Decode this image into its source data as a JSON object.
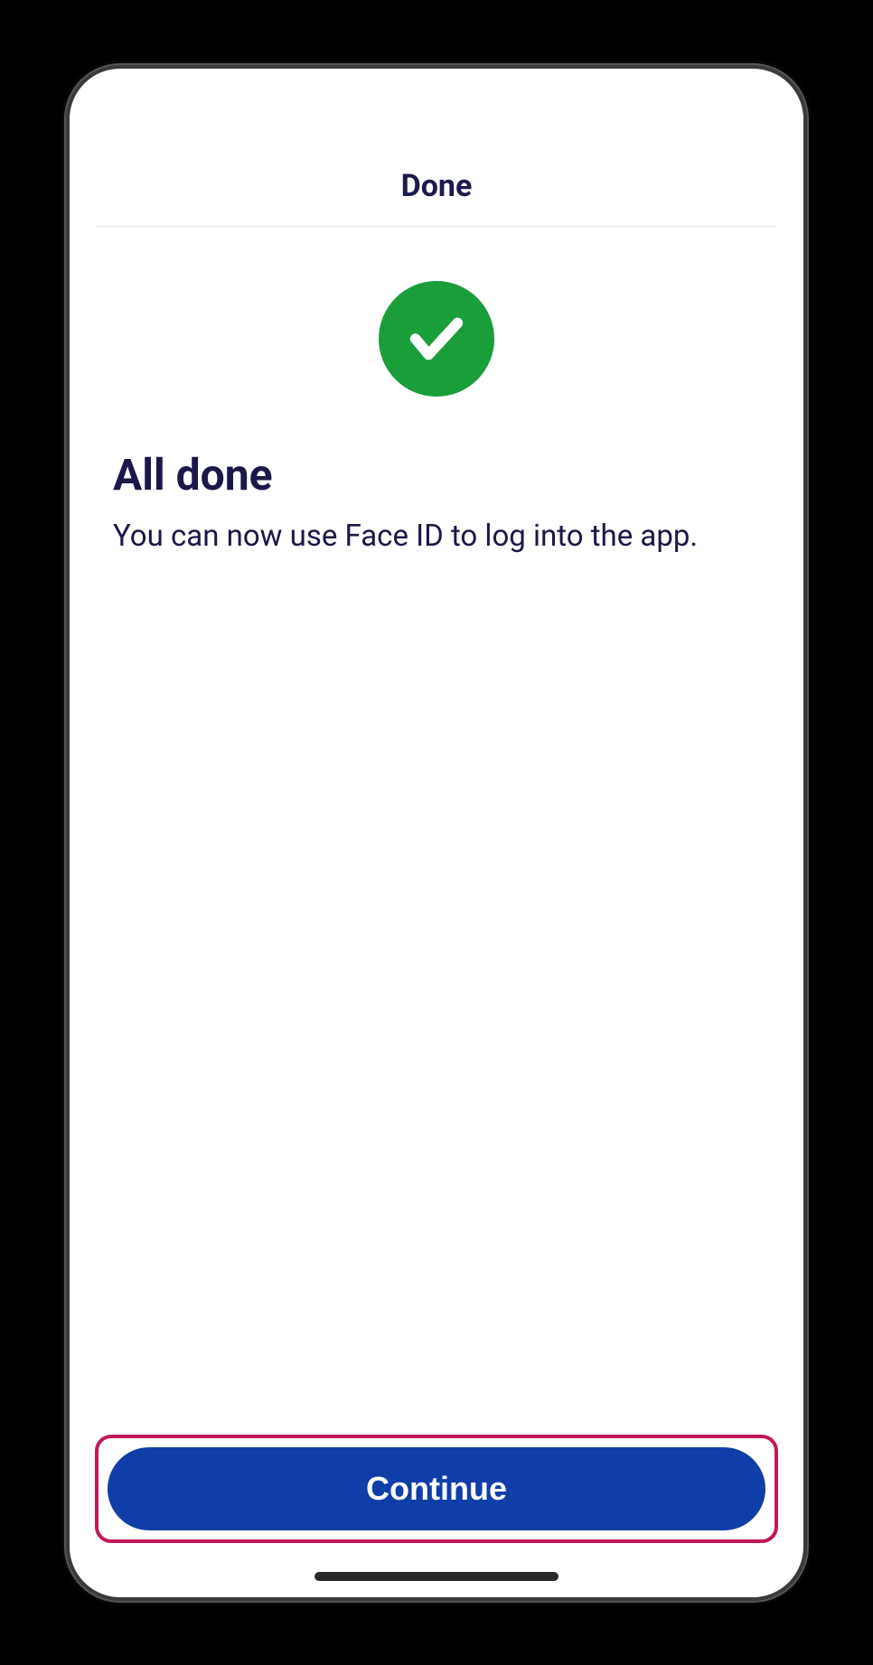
{
  "header": {
    "title": "Done"
  },
  "content": {
    "heading": "All done",
    "subtext": "You can now use Face ID to log into the app."
  },
  "footer": {
    "button_label": "Continue"
  }
}
